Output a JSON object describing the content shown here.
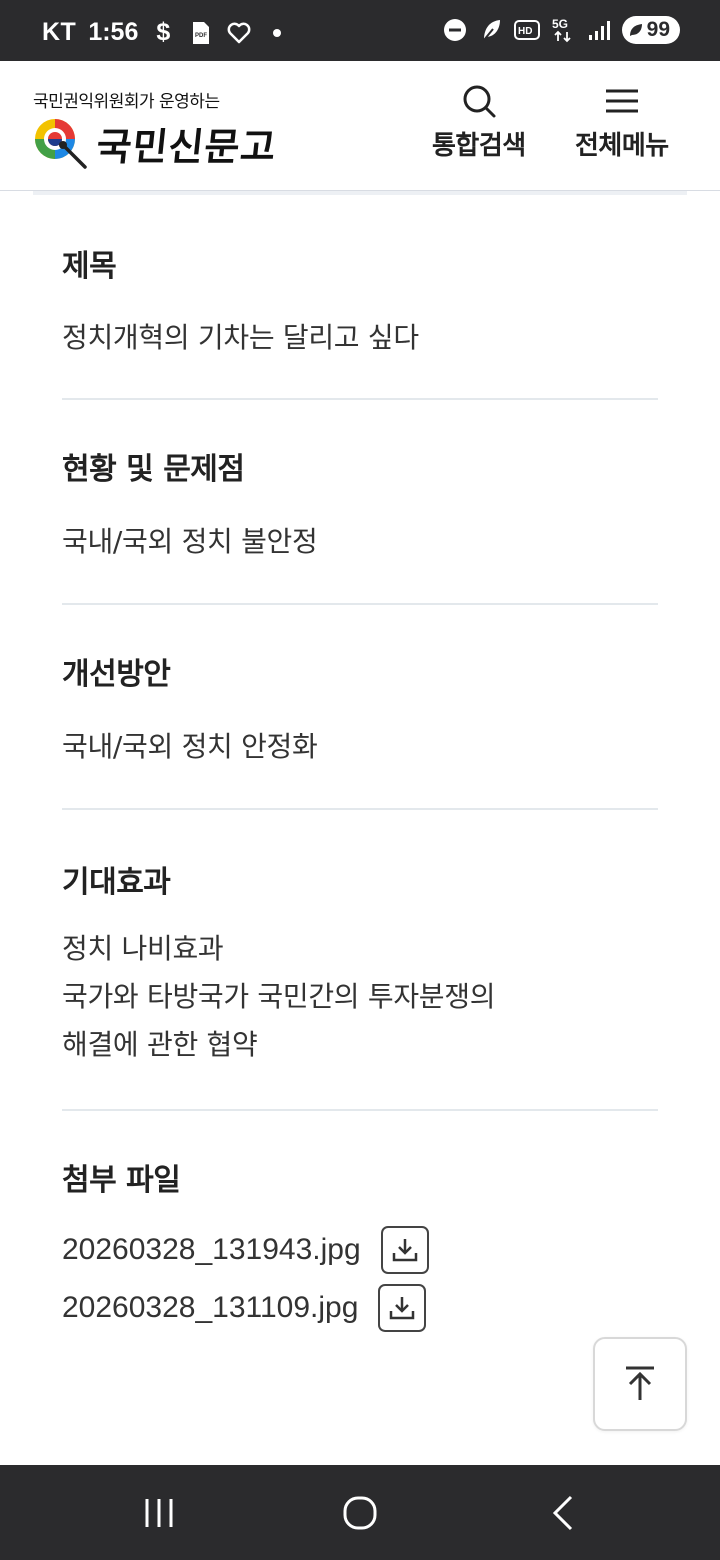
{
  "status_bar": {
    "carrier": "KT",
    "time": "1:56",
    "battery": "99",
    "icons": [
      "dollar-icon",
      "pdf-icon",
      "heart-icon",
      "dot-icon",
      "dnd-icon",
      "leaf-icon",
      "hd-icon",
      "5g-icon",
      "signal-icon",
      "battery-icon"
    ]
  },
  "header": {
    "logo_subtitle": "국민권익위원회가 운영하는",
    "logo_title": "국민신문고",
    "search_label": "통합검색",
    "menu_label": "전체메뉴"
  },
  "sections": [
    {
      "title": "제목",
      "body": [
        "정치개혁의 기차는 달리고 싶다"
      ]
    },
    {
      "title": "현황 및 문제점",
      "body": [
        "국내/국외 정치 불안정"
      ]
    },
    {
      "title": "개선방안",
      "body": [
        "국내/국외 정치 안정화"
      ]
    },
    {
      "title": "기대효과",
      "body": [
        "정치 나비효과",
        "국가와 타방국가 국민간의 투자분쟁의",
        "해결에 관한 협약"
      ]
    }
  ],
  "attachments": {
    "title": "첨부 파일",
    "files": [
      "20260328_131943.jpg",
      "20260328_131109.jpg"
    ]
  },
  "colors": {
    "status_bg": "#2b2b2d",
    "divider": "#e3e8ec",
    "text": "#222222"
  }
}
